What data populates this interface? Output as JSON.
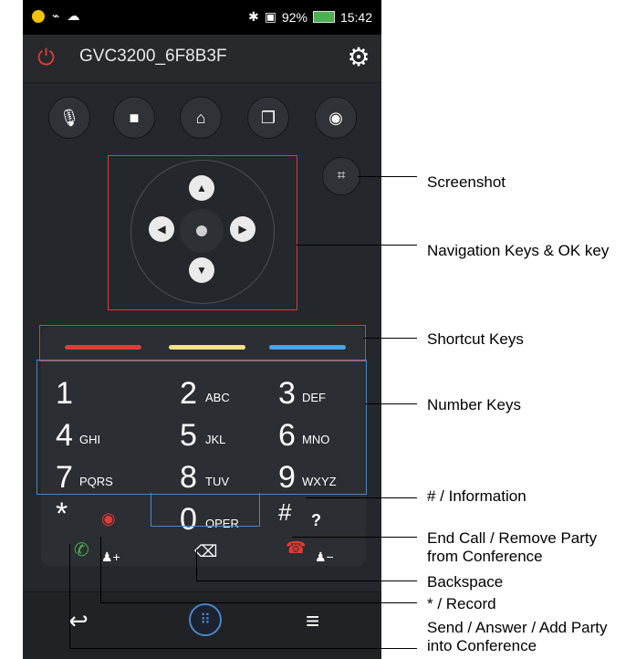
{
  "status_bar": {
    "battery": "92%",
    "time": "15:42"
  },
  "header": {
    "title": "GVC3200_6F8B3F"
  },
  "callouts": {
    "screenshot": "Screenshot",
    "navigation": "Navigation Keys & OK key",
    "shortcut": "Shortcut Keys",
    "number": "Number Keys",
    "hash": "# / Information",
    "end_call": "End Call / Remove Party from Conference",
    "backspace": "Backspace",
    "star": "* / Record",
    "send": "Send / Answer / Add Party into Conference"
  },
  "keypad": {
    "keys": [
      {
        "digit": "1",
        "letters": ""
      },
      {
        "digit": "2",
        "letters": "ABC"
      },
      {
        "digit": "3",
        "letters": "DEF"
      },
      {
        "digit": "4",
        "letters": "GHI"
      },
      {
        "digit": "5",
        "letters": "JKL"
      },
      {
        "digit": "6",
        "letters": "MNO"
      },
      {
        "digit": "7",
        "letters": "PQRS"
      },
      {
        "digit": "8",
        "letters": "TUV"
      },
      {
        "digit": "9",
        "letters": "WXYZ"
      },
      {
        "digit": "0",
        "letters": "OPER"
      }
    ],
    "star": "*",
    "hash": "#",
    "question": "?"
  },
  "colors": {
    "shortcut_red": "#e53935",
    "shortcut_yellow": "#f2e18a",
    "shortcut_blue": "#4aa3e8",
    "highlight_red": "#e53935",
    "highlight_blue": "#4a86c8"
  },
  "icons": [
    "power-icon",
    "settings-gear-icon",
    "mic-mute-icon",
    "camera-icon",
    "home-icon",
    "presentation-icon",
    "record-icon",
    "screenshot-icon",
    "arrow-up-icon",
    "arrow-down-icon",
    "arrow-left-icon",
    "arrow-right-icon",
    "ok-dot-icon",
    "call-icon",
    "add-party-icon",
    "backspace-icon",
    "end-call-icon",
    "remove-party-icon",
    "back-icon",
    "dialpad-icon",
    "menu-icon"
  ]
}
